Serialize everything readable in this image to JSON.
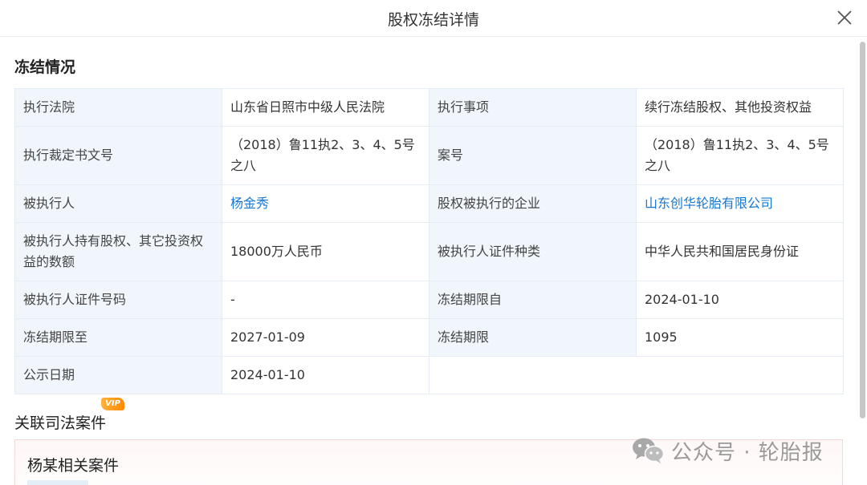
{
  "header": {
    "title": "股权冻结详情"
  },
  "section": {
    "title": "冻结情况"
  },
  "rows": [
    [
      {
        "label": "执行法院",
        "value": "山东省日照市中级人民法院"
      },
      {
        "label": "执行事项",
        "value": "续行冻结股权、其他投资权益"
      }
    ],
    [
      {
        "label": "执行裁定书文号",
        "value": "（2018）鲁11执2、3、4、5号之八"
      },
      {
        "label": "案号",
        "value": "（2018）鲁11执2、3、4、5号之八"
      }
    ],
    [
      {
        "label": "被执行人",
        "value": "杨金秀"
      },
      {
        "label": "股权被执行的企业",
        "value": "山东创华轮胎有限公司"
      }
    ],
    [
      {
        "label": "被执行人持有股权、其它投资权益的数额",
        "value": "18000万人民币"
      },
      {
        "label": "被执行人证件种类",
        "value": "中华人民共和国居民身份证"
      }
    ],
    [
      {
        "label": "被执行人证件号码",
        "value": "-"
      },
      {
        "label": "冻结期限自",
        "value": "2024-01-10"
      }
    ],
    [
      {
        "label": "冻结期限至",
        "value": "2027-01-09"
      },
      {
        "label": "冻结期限",
        "value": "1095"
      }
    ],
    [
      {
        "label": "公示日期",
        "value": "2024-01-10"
      }
    ]
  ],
  "related": {
    "title": "关联司法案件",
    "badge": "VIP"
  },
  "case": {
    "title": "杨某相关案件"
  },
  "watermark": {
    "text": "公众号 · 轮胎报"
  },
  "icons": {
    "close": "close-icon",
    "watermark": "wechat-icon"
  },
  "colors": {
    "link": "#1677d2",
    "label_bg": "#f0f6fc",
    "vip": "#ff9a1f"
  }
}
